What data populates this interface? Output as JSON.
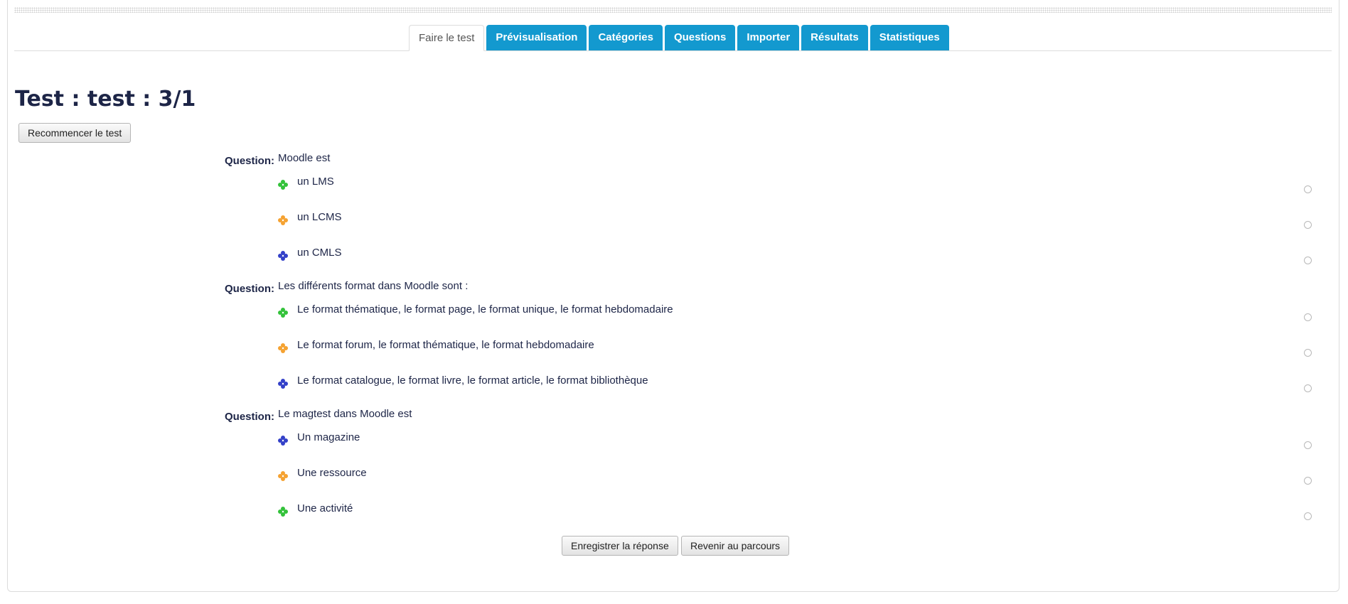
{
  "tabs": [
    {
      "label": "Faire le test",
      "active": true
    },
    {
      "label": "Prévisualisation"
    },
    {
      "label": "Catégories"
    },
    {
      "label": "Questions"
    },
    {
      "label": "Importer"
    },
    {
      "label": "Résultats"
    },
    {
      "label": "Statistiques"
    }
  ],
  "page_title": "Test : test : 3/1",
  "restart_button": "Recommencer le test",
  "question_label": "Question:",
  "colors": {
    "green": "#33c23a",
    "orange": "#f5a231",
    "blue": "#3340c8",
    "tab_blue": "#1399cf"
  },
  "questions": [
    {
      "text": "Moodle est",
      "answers": [
        {
          "text": "un LMS",
          "icon": "green-clover-icon",
          "color": "green"
        },
        {
          "text": "un LCMS",
          "icon": "orange-clover-icon",
          "color": "orange"
        },
        {
          "text": "un CMLS",
          "icon": "blue-clover-icon",
          "color": "blue"
        }
      ]
    },
    {
      "text": "Les différents format dans Moodle sont :",
      "answers": [
        {
          "text": "Le format thématique, le format page, le format unique, le format hebdomadaire",
          "icon": "green-clover-icon",
          "color": "green"
        },
        {
          "text": "Le format forum, le format thématique, le format hebdomadaire",
          "icon": "orange-clover-icon",
          "color": "orange"
        },
        {
          "text": "Le format catalogue, le format livre, le format article, le format bibliothèque",
          "icon": "blue-clover-icon",
          "color": "blue"
        }
      ]
    },
    {
      "text": "Le magtest dans Moodle est",
      "answers": [
        {
          "text": "Un magazine",
          "icon": "blue-clover-icon",
          "color": "blue"
        },
        {
          "text": "Une ressource",
          "icon": "orange-clover-icon",
          "color": "orange"
        },
        {
          "text": "Une activité",
          "icon": "green-clover-icon",
          "color": "green"
        }
      ]
    }
  ],
  "save_button": "Enregistrer la réponse",
  "back_button": "Revenir au parcours"
}
